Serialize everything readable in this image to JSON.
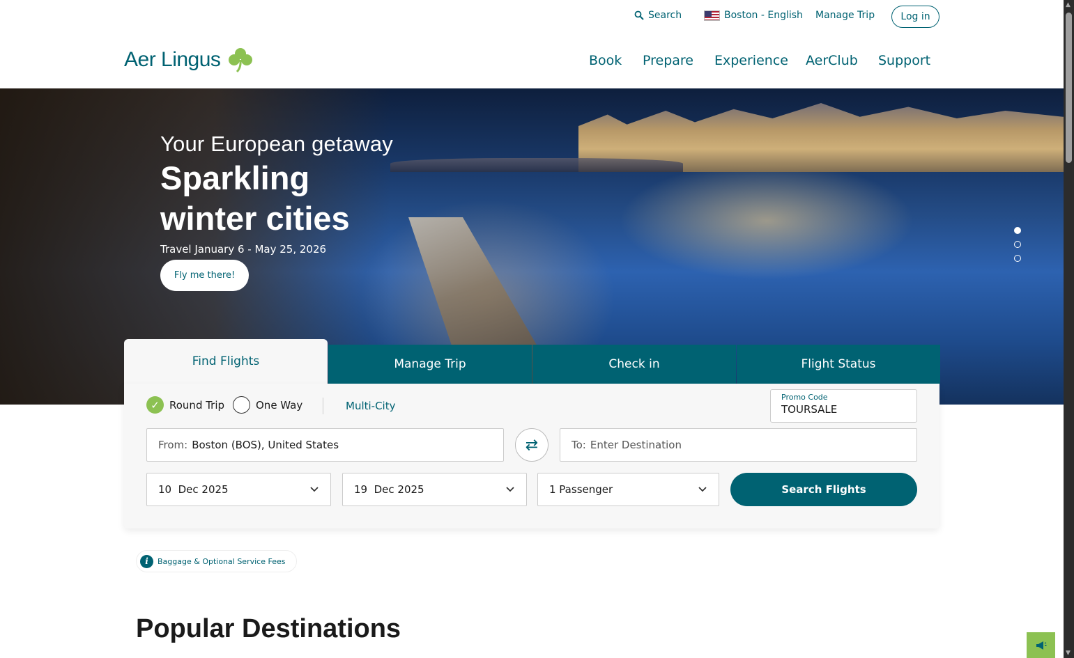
{
  "utility": {
    "search_label": "Search",
    "region_label": "Boston - English",
    "manage_label": "Manage Trip",
    "login_label": "Log in"
  },
  "logo": {
    "text": "Aer Lingus"
  },
  "nav": {
    "items": [
      "Book",
      "Prepare",
      "Experience",
      "AerClub",
      "Support"
    ]
  },
  "hero": {
    "kicker": "Your European getaway",
    "title_line1": "Sparkling",
    "title_line2": "winter cities",
    "subtitle": "Travel January 6 - May 25, 2026",
    "cta_label": "Fly me there!",
    "slides_total": 3,
    "active_slide": 1
  },
  "booking": {
    "tabs": [
      "Find Flights",
      "Manage Trip",
      "Check in",
      "Flight Status"
    ],
    "active_tab": "Find Flights",
    "trip_types": {
      "round": "Round Trip",
      "oneway": "One Way",
      "multi": "Multi-City"
    },
    "selected_trip_type": "Round Trip",
    "promo": {
      "label": "Promo Code",
      "value": "TOURSALE"
    },
    "from": {
      "prefix": "From:",
      "value": "Boston (BOS), United States"
    },
    "to": {
      "prefix": "To:",
      "placeholder": "Enter Destination"
    },
    "depart_date": "10  Dec 2025",
    "return_date": "19  Dec 2025",
    "passengers": "1 Passenger",
    "search_label": "Search Flights"
  },
  "baggage_link": "Baggage & Optional Service Fees",
  "section_title": "Popular Destinations",
  "colors": {
    "brand": "#006272",
    "accent_green": "#8cc152"
  },
  "icons": [
    "search-icon",
    "us-flag-icon",
    "shamrock-icon",
    "check-icon",
    "swap-icon",
    "chevron-down-icon",
    "info-icon",
    "megaphone-icon"
  ]
}
